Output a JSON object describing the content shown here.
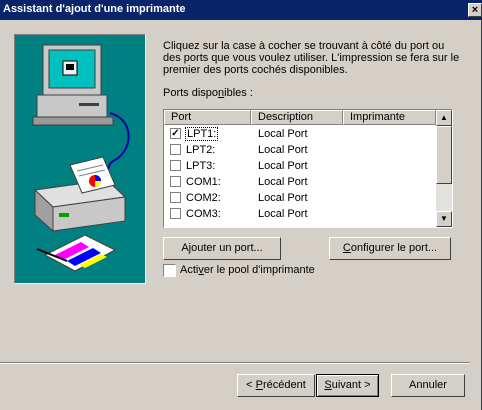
{
  "window": {
    "title": "Assistant d'ajout d'une imprimante",
    "close_label": "×"
  },
  "instructions": "Cliquez sur la case à cocher se trouvant à côté du port ou des ports que vous voulez utiliser. L'impression se fera sur le premier des ports cochés disponibles.",
  "ports_label": "Ports disponibles :",
  "columns": [
    "Port",
    "Description",
    "Imprimante"
  ],
  "ports": [
    {
      "name": "LPT1:",
      "description": "Local Port",
      "checked": true
    },
    {
      "name": "LPT2:",
      "description": "Local Port",
      "checked": false
    },
    {
      "name": "LPT3:",
      "description": "Local Port",
      "checked": false
    },
    {
      "name": "COM1:",
      "description": "Local Port",
      "checked": false
    },
    {
      "name": "COM2:",
      "description": "Local Port",
      "checked": false
    },
    {
      "name": "COM3:",
      "description": "Local Port",
      "checked": false
    }
  ],
  "buttons": {
    "add_port": "Ajouter un port...",
    "configure_port": "Configurer le port...",
    "previous": "< Précédent",
    "next": "Suivant >",
    "cancel": "Annuler"
  },
  "pool_checkbox": {
    "label": "Activer le pool d'imprimante",
    "checked": false
  },
  "scroll_icons": {
    "up": "▲",
    "down": "▼"
  },
  "colors": {
    "titlebar": "#0a246a",
    "illustration_bg": "#008080",
    "face": "#d4d0c8"
  }
}
